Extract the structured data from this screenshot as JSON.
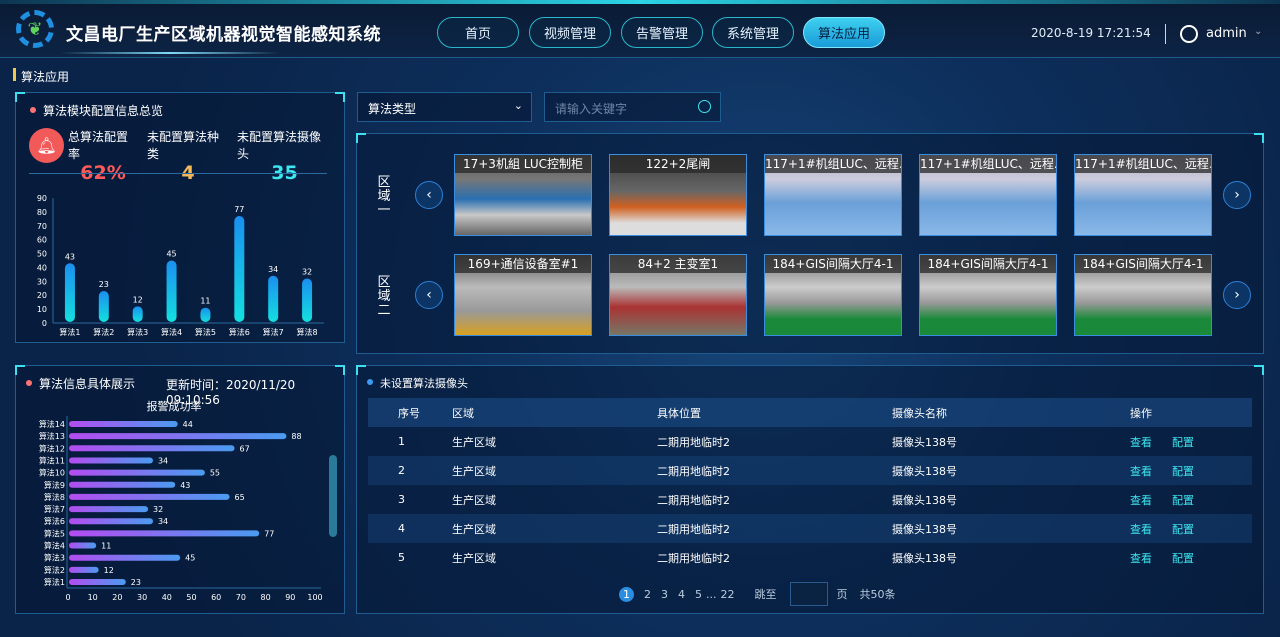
{
  "header": {
    "title": "文昌电厂生产区域机器视觉智能感知系统",
    "datetime": "2020-8-19  17:21:54",
    "user": "admin",
    "nav": [
      {
        "label": "首页"
      },
      {
        "label": "视频管理"
      },
      {
        "label": "告警管理"
      },
      {
        "label": "系统管理"
      },
      {
        "label": "算法应用",
        "active": true
      }
    ]
  },
  "breadcrumb": "算法应用",
  "overview": {
    "title": "算法模块配置信息总览",
    "stats": [
      {
        "label": "总算法配置率",
        "value": "62%",
        "color": "#ff5a5a"
      },
      {
        "label": "未配置算法种类",
        "value": "4",
        "color": "#f5b85a"
      },
      {
        "label": "未配置算法摄像头",
        "value": "35",
        "color": "#3ee6f0"
      }
    ]
  },
  "detail": {
    "title": "算法信息具体展示",
    "update_time": "更新时间：2020/11/20 09:10:56"
  },
  "chart_data": [
    {
      "type": "bar",
      "categories": [
        "算法1",
        "算法2",
        "算法3",
        "算法4",
        "算法5",
        "算法6",
        "算法7",
        "算法8"
      ],
      "values": [
        43,
        23,
        12,
        45,
        11,
        77,
        34,
        32
      ],
      "ylim": [
        0,
        90
      ],
      "yticks": [
        0,
        10,
        20,
        30,
        40,
        50,
        60,
        70,
        80,
        90
      ],
      "data_labels": true
    },
    {
      "type": "bar",
      "orientation": "horizontal",
      "title": "报警成功率",
      "categories": [
        "算法14",
        "算法13",
        "算法12",
        "算法11",
        "算法10",
        "算法9",
        "算法8",
        "算法7",
        "算法6",
        "算法5",
        "算法4",
        "算法3",
        "算法2",
        "算法1"
      ],
      "values": [
        44,
        88,
        67,
        34,
        55,
        43,
        65,
        32,
        34,
        77,
        11,
        45,
        12,
        23
      ],
      "xlim": [
        0,
        100
      ],
      "xticks": [
        0,
        10,
        20,
        30,
        40,
        50,
        60,
        70,
        80,
        90,
        100
      ],
      "data_labels": true
    }
  ],
  "filters": {
    "type_select": "算法类型",
    "search_placeholder": "请输入关键字"
  },
  "cameras": {
    "rows": [
      {
        "region": "区域一",
        "items": [
          "17+3机組 LUC控制柜",
          "122+2尾闸",
          "117+1#机组LUC、远程...",
          "117+1#机组LUC、远程...",
          "117+1#机组LUC、远程..."
        ]
      },
      {
        "region": "区域二",
        "items": [
          "169+通信设备室#1",
          "84+2 主变室1",
          "184+GIS间隔大厅4-1",
          "184+GIS间隔大厅4-1",
          "184+GIS间隔大厅4-1"
        ]
      }
    ]
  },
  "table": {
    "title": "未设置算法摄像头",
    "headers": [
      "序号",
      "区域",
      "具体位置",
      "摄像头名称",
      "操作"
    ],
    "rows": [
      [
        "1",
        "生产区域",
        "二期用地临时2",
        "摄像头138号"
      ],
      [
        "2",
        "生产区域",
        "二期用地临时2",
        "摄像头138号"
      ],
      [
        "3",
        "生产区域",
        "二期用地临时2",
        "摄像头138号"
      ],
      [
        "4",
        "生产区域",
        "二期用地临时2",
        "摄像头138号"
      ],
      [
        "5",
        "生产区域",
        "二期用地临时2",
        "摄像头138号"
      ]
    ],
    "actions": [
      "查看",
      "配置"
    ]
  },
  "pagination": {
    "pages": [
      "1",
      "2",
      "3",
      "4",
      "5",
      "...",
      "22"
    ],
    "current": "1",
    "jump_label": "跳至",
    "page_unit": "页",
    "total": "共50条"
  }
}
